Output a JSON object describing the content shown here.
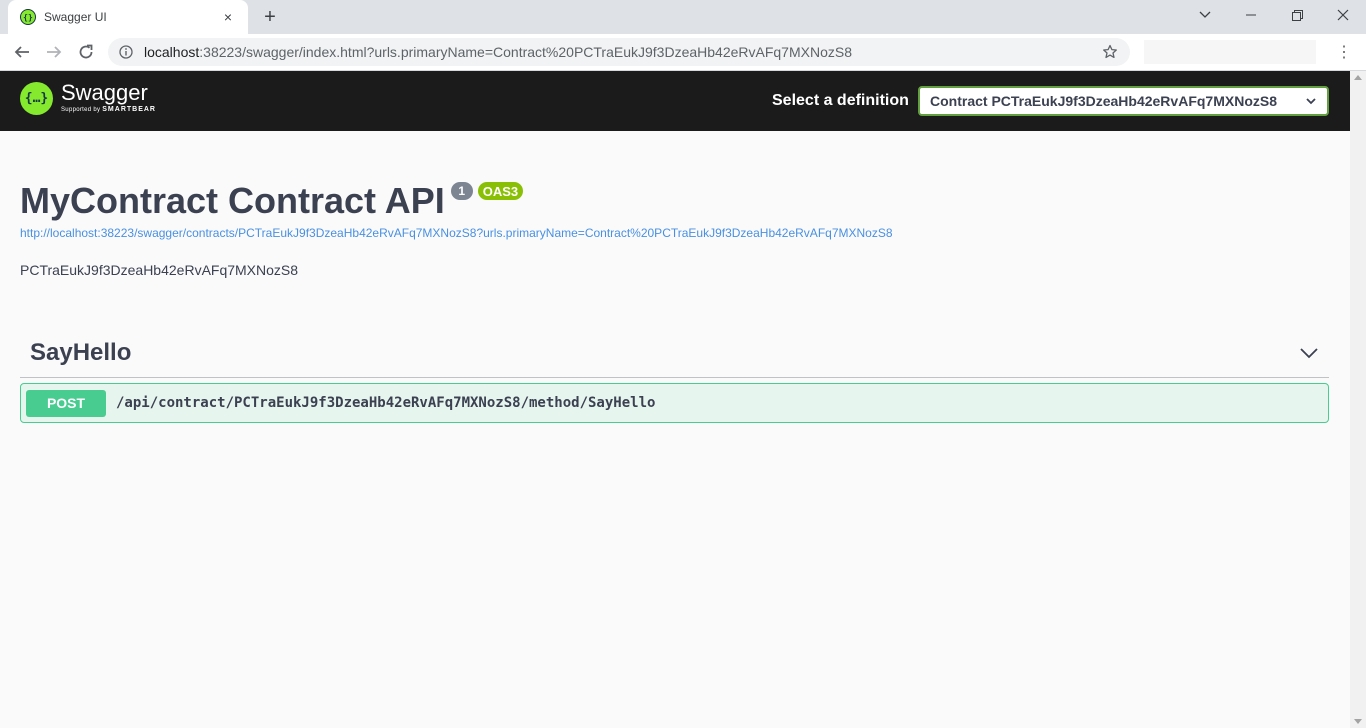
{
  "browser": {
    "tab_title": "Swagger UI",
    "tab_favicon": "swagger-favicon",
    "tab_close": "×",
    "new_tab": "+",
    "url_host": "localhost",
    "url_rest": ":38223/swagger/index.html?urls.primaryName=Contract%20PCTraEukJ9f3DzeaHb42eRvAFq7MXNozS8",
    "menu": "⋮"
  },
  "topbar": {
    "logo_mark": "{…}",
    "logo_name": "Swagger",
    "logo_sub_prefix": "Supported by",
    "logo_sub_brand": "SMARTBEAR",
    "definition_label": "Select a definition",
    "definition_selected": "Contract PCTraEukJ9f3DzeaHb42eRvAFq7MXNozS8"
  },
  "info": {
    "title": "MyContract Contract API",
    "version": "1",
    "oas_badge": "OAS3",
    "spec_url": "http://localhost:38223/swagger/contracts/PCTraEukJ9f3DzeaHb42eRvAFq7MXNozS8?urls.primaryName=Contract%20PCTraEukJ9f3DzeaHb42eRvAFq7MXNozS8",
    "description": "PCTraEukJ9f3DzeaHb42eRvAFq7MXNozS8"
  },
  "tags": [
    {
      "name": "SayHello",
      "operations": [
        {
          "method": "POST",
          "path": "/api/contract/PCTraEukJ9f3DzeaHb42eRvAFq7MXNozS8/method/SayHello"
        }
      ]
    }
  ],
  "colors": {
    "topbar_bg": "#1b1b1b",
    "swagger_green": "#85ea2d",
    "post_green": "#49cc90",
    "oas_badge": "#89bf04",
    "version_badge": "#7d8492",
    "link_blue": "#4990e2",
    "text_dark": "#3b4151"
  }
}
